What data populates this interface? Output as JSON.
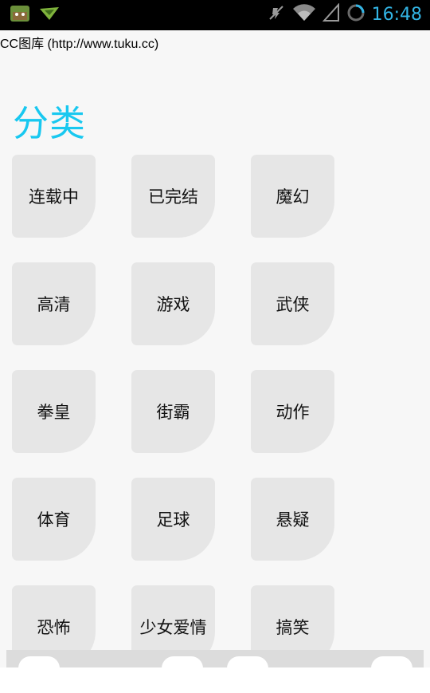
{
  "status_bar": {
    "time": "16:48",
    "icons": [
      "app-thumbnail-icon",
      "paper-plane-icon",
      "mute-icon",
      "wifi-icon",
      "signal-icon",
      "loading-ring-icon"
    ]
  },
  "page": {
    "title_line": "CC图库 (http://www.tuku.cc)"
  },
  "section": {
    "title": "分类"
  },
  "categories": [
    {
      "label": "连载中"
    },
    {
      "label": "已完结"
    },
    {
      "label": "魔幻"
    },
    {
      "label": "高清"
    },
    {
      "label": "游戏"
    },
    {
      "label": "武侠"
    },
    {
      "label": "拳皇"
    },
    {
      "label": "街霸"
    },
    {
      "label": "动作"
    },
    {
      "label": "体育"
    },
    {
      "label": "足球"
    },
    {
      "label": "悬疑"
    },
    {
      "label": "恐怖"
    },
    {
      "label": "少女爱情"
    },
    {
      "label": "搞笑"
    }
  ],
  "colors": {
    "accent": "#18c8f0",
    "status_bar_bg": "#000000",
    "status_text": "#33b5e5",
    "tile_bg": "#e6e6e6",
    "page_bg": "#f7f7f7"
  }
}
